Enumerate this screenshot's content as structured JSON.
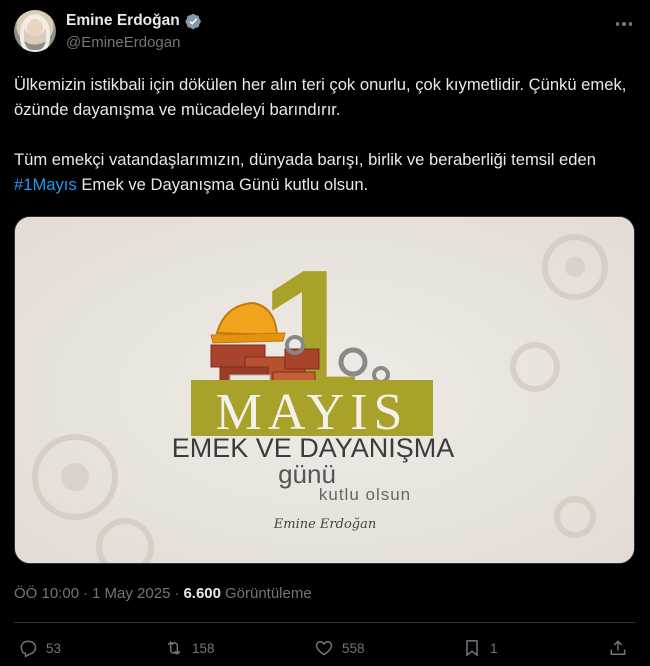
{
  "author": {
    "name": "Emine Erdoğan",
    "handle": "@EmineErdogan"
  },
  "tweet": {
    "paragraph1": "Ülkemizin istikbali için dökülen her alın teri çok onurlu, çok kıymetlidir. Çünkü emek, özünde dayanışma ve mücadeleyi barındırır.",
    "paragraph2_before": "Tüm emekçi vatandaşlarımızın, dünyada barışı, birlik ve beraberliği temsil eden ",
    "hashtag": "#1Mayıs",
    "paragraph2_after": " Emek ve Dayanışma Günü kutlu olsun."
  },
  "image": {
    "big_number": "1",
    "month": "MAYIS",
    "line1": "EMEK VE DAYANIŞMA",
    "line2": "günü",
    "line3": "kutlu olsun",
    "signature": "Emine Erdoğan",
    "accent_color": "#a8a22a"
  },
  "meta": {
    "time": "ÖÖ 10:00",
    "separator": "·",
    "date": "1 May 2025",
    "views": "6.600",
    "views_label": "Görüntüleme"
  },
  "actions": {
    "replies": "53",
    "reposts": "158",
    "likes": "558",
    "bookmarks": "1"
  },
  "colors": {
    "background": "#000000",
    "text": "#e7e9ea",
    "muted": "#71767b",
    "link": "#1d9bf0",
    "verified": "#829aab"
  }
}
